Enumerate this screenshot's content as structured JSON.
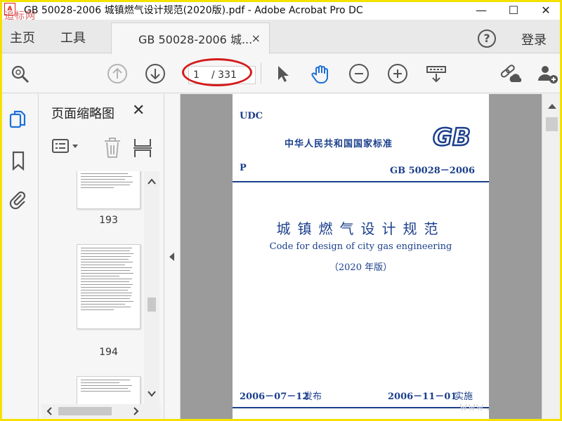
{
  "window": {
    "title": "GB 50028-2006 城镇燃气设计规范(2020版).pdf - Adobe Acrobat Pro DC",
    "watermark_top_left": "追标网",
    "controls": [
      "—",
      "☐",
      "✕"
    ]
  },
  "tabs": {
    "home": "主页",
    "tools": "工具",
    "document": "GB 50028-2006 城...",
    "close": "×",
    "help": "?",
    "login": "登录"
  },
  "toolbar": {
    "current_page": "1",
    "total_pages": "/ 331",
    "icons": [
      "search-icon",
      "page-up-icon",
      "page-down-icon",
      "select-cursor-icon",
      "hand-tool-icon",
      "zoom-out-icon",
      "zoom-in-icon",
      "scroll-mode-icon",
      "share-link-icon",
      "add-user-icon"
    ],
    "highlight_color": "#d41a1a"
  },
  "sidebar": {
    "panel_title": "页面缩略图",
    "panel_close": "✕",
    "thumbnails": [
      {
        "label": "193"
      },
      {
        "label": "194"
      }
    ]
  },
  "document": {
    "udc": "UDC",
    "standard": "中华人民共和国国家标准",
    "logo": "GB",
    "category": "P",
    "code": "GB 50028－2006",
    "title_cn": "城镇燃气设计规范",
    "title_en": "Code for design of city gas engineering",
    "edition": "（2020 年版）",
    "publish_date": "2006－07－12",
    "publish_label": "发布",
    "effective_date": "2006－11－01",
    "effective_label": "实施",
    "accent_color": "#1b3f8c"
  },
  "watermark_bottom_right": "www."
}
